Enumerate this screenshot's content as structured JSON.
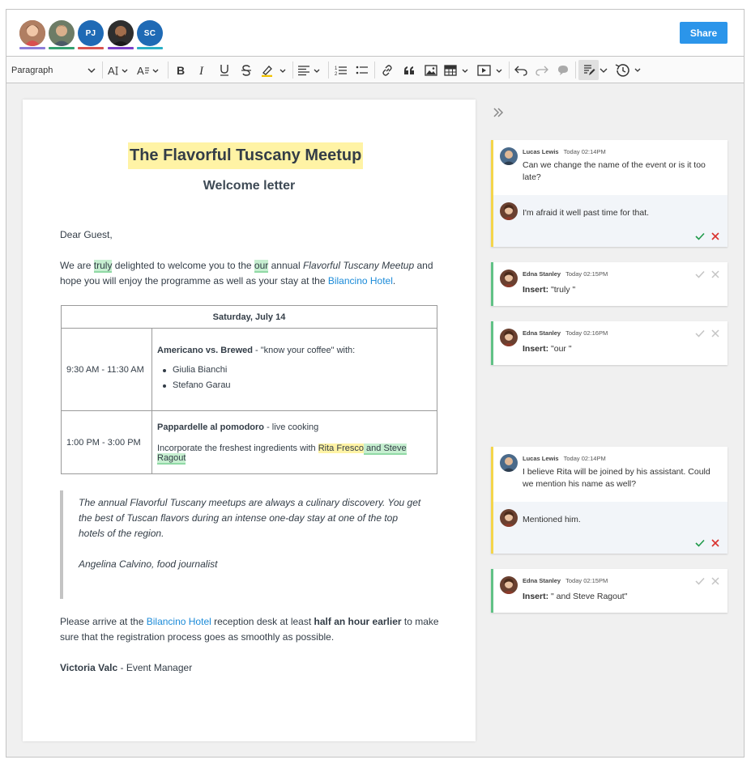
{
  "presence": {
    "users": [
      {
        "name": "user-1",
        "initials": "",
        "bar_color": "#8d7ed9",
        "bg": "#6a4a3a"
      },
      {
        "name": "user-2",
        "initials": "",
        "bar_color": "#34a170",
        "bg": "#5a6d5a"
      },
      {
        "name": "user-3",
        "initials": "PJ",
        "bar_color": "#d9534f",
        "bg": "#1f6ab5"
      },
      {
        "name": "user-4",
        "initials": "",
        "bar_color": "#7c3fc9",
        "bg": "#3a3a3a"
      },
      {
        "name": "user-5",
        "initials": "SC",
        "bar_color": "#2ab0c6",
        "bg": "#1f6ab5"
      }
    ],
    "share_label": "Share"
  },
  "toolbar": {
    "heading_select": "Paragraph",
    "icons": [
      "font-size-icon",
      "font-family-icon",
      "bold-icon",
      "italic-icon",
      "underline-icon",
      "strikethrough-icon",
      "highlight-icon",
      "align-icon",
      "numbered-list-icon",
      "bulleted-list-icon",
      "link-icon",
      "blockquote-icon",
      "image-icon",
      "table-icon",
      "media-icon",
      "undo-icon",
      "redo-icon",
      "comment-icon",
      "track-changes-icon",
      "revision-history-icon"
    ]
  },
  "doc": {
    "title": "The Flavorful Tuscany Meetup",
    "subtitle": "Welcome letter",
    "greeting": "Dear Guest,",
    "p1": {
      "a": "We are ",
      "truly": "truly",
      "b": " delighted to welcome you to the ",
      "our": "our",
      "c": " annual ",
      "event": "Flavorful Tuscany Meetup",
      "d": " and hope you will enjoy the programme as well as your stay at the ",
      "hotel": "Bilancino Hotel",
      "e": "."
    },
    "table": {
      "header": "Saturday, July 14",
      "row1_time": "9:30 AM - 11:30 AM",
      "row1_title": "Americano vs. Brewed",
      "row1_rest": " - \"know your coffee\" with:",
      "row1_items": [
        "Giulia Bianchi",
        "Stefano Garau"
      ],
      "row2_time": "1:00 PM - 3:00 PM",
      "row2_title": "Pappardelle al pomodoro",
      "row2_rest": " - live cooking",
      "row2_desc": "Incorporate the freshest ingredients with ",
      "row2_rita": "Rita Fresco",
      "row2_steve": " and Steve Ragout"
    },
    "quote_text": "The annual Flavorful Tuscany meetups are always a culinary discovery. You get the best of Tuscan flavors during an intense one-day stay at one of the top hotels of the region.",
    "quote_author": "Angelina Calvino, food journalist",
    "p3": {
      "a": "Please arrive at the ",
      "hotel": "Bilancino Hotel",
      "b": " reception desk at least ",
      "bold": "half an hour earlier",
      "c": " to make sure that the registration process goes as smoothly as possible."
    },
    "sign_name": "Victoria Valc",
    "sign_role": " - Event Manager"
  },
  "sidebar": {
    "threads": [
      {
        "author": "Lucas Lewis",
        "time": "Today 02:14PM",
        "text": "Can we change the name of the event or is it too late?",
        "reply_text": "I'm afraid it well past time for that."
      },
      {
        "author": "Edna Stanley",
        "time": "Today 02:15PM",
        "label": "Insert:",
        "value": " \"truly \""
      },
      {
        "author": "Edna Stanley",
        "time": "Today 02:16PM",
        "label": "Insert:",
        "value": " \"our \""
      },
      {
        "author": "Lucas Lewis",
        "time": "Today 02:14PM",
        "text": "I believe Rita will be joined by his assistant. Could we mention his name as well?",
        "reply_text": "Mentioned him."
      },
      {
        "author": "Edna Stanley",
        "time": "Today 02:15PM",
        "label": "Insert:",
        "value": " \" and Steve Ragout\""
      }
    ]
  }
}
